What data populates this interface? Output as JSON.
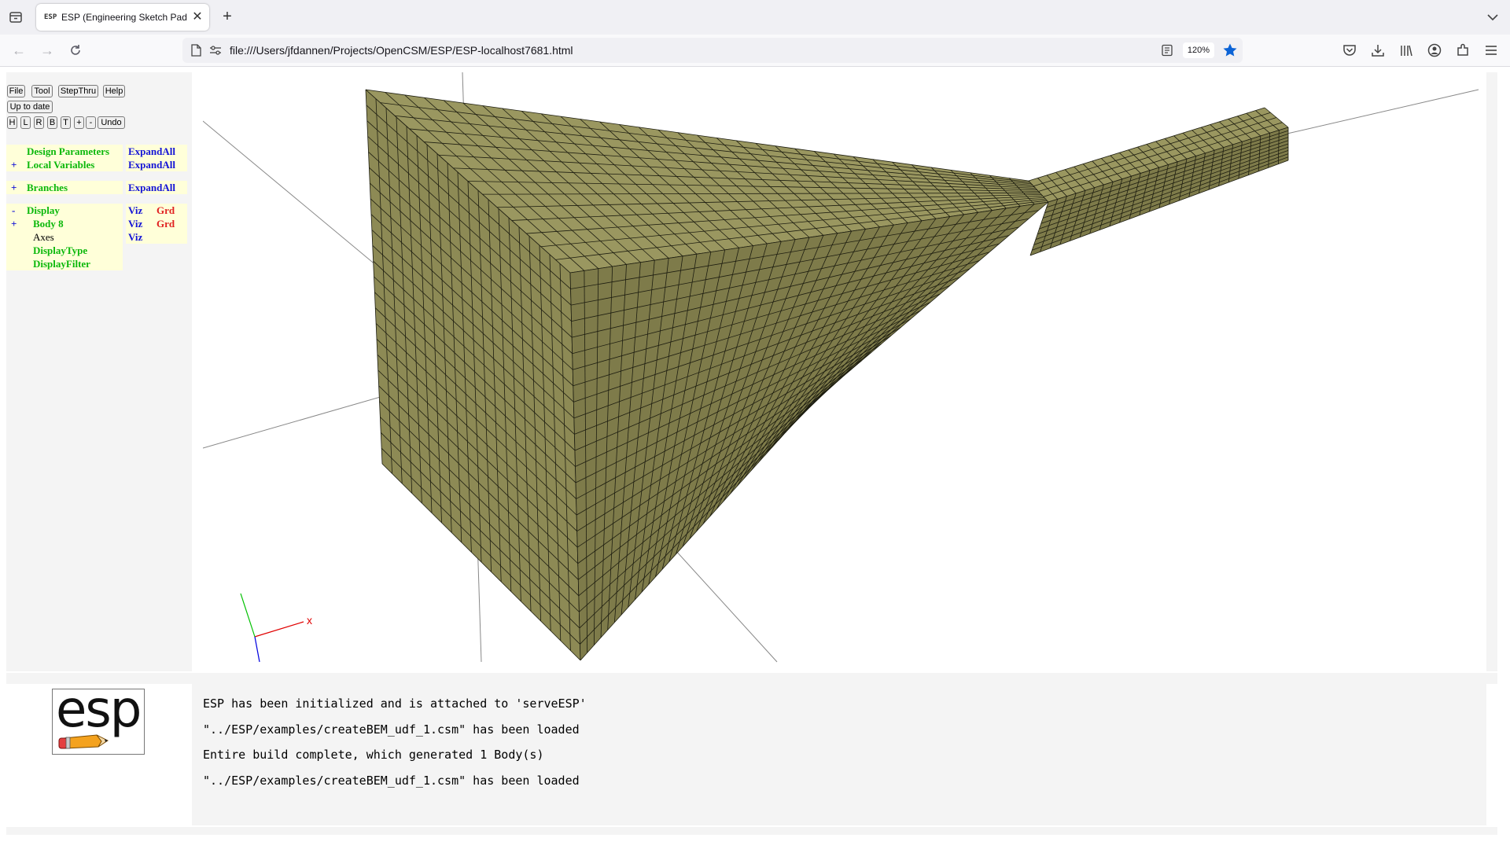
{
  "browser": {
    "tab_title": "ESP (Engineering Sketch Pad, V",
    "favicon_text": "ESP",
    "url": "file:///Users/jfdannen/Projects/OpenCSM/ESP/ESP-localhost7681.html",
    "zoom": "120%"
  },
  "toolbar": {
    "file": "File",
    "tool": "Tool",
    "stepthru": "StepThru",
    "help": "Help",
    "status": "Up to date",
    "view_h": "H",
    "view_l": "L",
    "view_r": "R",
    "view_b": "B",
    "view_t": "T",
    "zoom_in": "+",
    "zoom_out": "-",
    "undo": "Undo"
  },
  "tree": {
    "design_parameters": "Design Parameters",
    "local_variables": "Local Variables",
    "branches": "Branches",
    "display": "Display",
    "body": "Body 8",
    "axes": "Axes",
    "display_type": "DisplayType",
    "display_filter": "DisplayFilter",
    "expand_all": "ExpandAll",
    "plus": "+",
    "minus": "-",
    "viz": "Viz",
    "grd": "Grd"
  },
  "logo": "esp",
  "messages": [
    "ESP has been initialized and is attached to 'serveESP'",
    "\"../ESP/examples/createBEM_udf_1.csm\" has been loaded",
    "Entire build complete, which generated 1 Body(s)",
    "\"../ESP/examples/createBEM_udf_1.csm\" has been loaded"
  ],
  "axes_label_x": "x",
  "colors": {
    "mesh_front": "#8d8a55",
    "mesh_side": "#7e7b4a",
    "mesh_top": "#9a9760",
    "tree_green": "#0bb80b",
    "tree_blue": "#1313d6",
    "tree_red": "#e02020",
    "tree_bg": "#ffffd9"
  }
}
